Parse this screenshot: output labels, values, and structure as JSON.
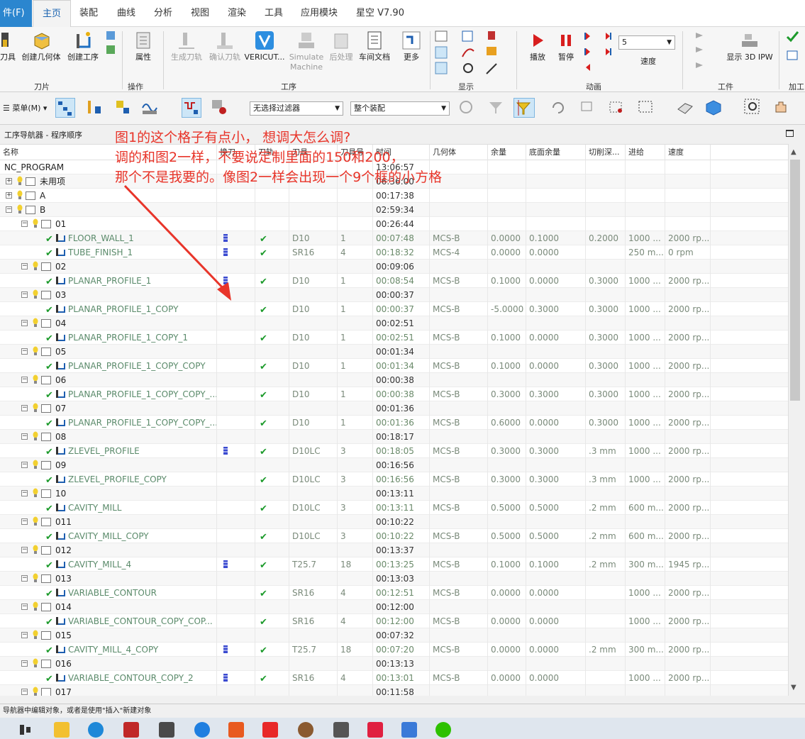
{
  "menu": {
    "file": "件(F)",
    "tabs": [
      "主页",
      "装配",
      "曲线",
      "分析",
      "视图",
      "渲染",
      "工具",
      "应用模块",
      "星空 V7.90"
    ]
  },
  "ribbon": {
    "buttons": {
      "tool": "刀具",
      "create_geometry": "创建几何体",
      "create_process": "创建工序",
      "attribute": "属性",
      "gen_toolpath": "生成刀轨",
      "verify_toolpath": "确认刀轨",
      "vericut": "VERICUT...",
      "simulate": "Simulate Machine",
      "post": "后处理",
      "shop_doc": "车间文档",
      "more": "更多",
      "play": "播放",
      "pause": "暂停",
      "speed": "速度",
      "speed_value": "5",
      "show_ipw": "显示 3D IPW"
    },
    "groups": {
      "cutter": "刀片",
      "operation": "操作",
      "process": "工序",
      "display": "显示",
      "animation": "动画",
      "workpiece": "工件",
      "machining": "加工"
    }
  },
  "toolbar": {
    "menu_label": "菜单(M)",
    "filter_select": "无选择过滤器",
    "assembly_select": "整个装配"
  },
  "navigator": {
    "title": "工序导航器 - 程序顺序",
    "columns": [
      "名称",
      "换刀",
      "刀轨",
      "刀具",
      "刀具号",
      "时间",
      "几何体",
      "余量",
      "底面余量",
      "切削深...",
      "进给",
      "速度"
    ],
    "rows": [
      {
        "name": "NC_PROGRAM",
        "time": "13:06:57"
      },
      {
        "name": "未用项",
        "time": "06:36:00"
      },
      {
        "name": "A",
        "time": "00:17:38"
      },
      {
        "name": "B",
        "time": "02:59:34"
      },
      {
        "name": "01",
        "time": "00:26:44"
      },
      {
        "name": "FLOOR_WALL_1",
        "tool": "D10",
        "toolno": "1",
        "time": "00:07:48",
        "geom": "MCS-B",
        "stock": "0.0000",
        "floor": "0.1000",
        "depth": "0.2000",
        "feed": "1000 ...",
        "speed": "2000 rp..."
      },
      {
        "name": "TUBE_FINISH_1",
        "tool": "SR16",
        "toolno": "4",
        "time": "00:18:32",
        "geom": "MCS-4",
        "stock": "0.0000",
        "floor": "0.0000",
        "depth": "",
        "feed": "250 m...",
        "speed": "0 rpm"
      },
      {
        "name": "02",
        "time": "00:09:06"
      },
      {
        "name": "PLANAR_PROFILE_1",
        "tool": "D10",
        "toolno": "1",
        "time": "00:08:54",
        "geom": "MCS-B",
        "stock": "0.1000",
        "floor": "0.0000",
        "depth": "0.3000",
        "feed": "1000 ...",
        "speed": "2000 rp..."
      },
      {
        "name": "03",
        "time": "00:00:37"
      },
      {
        "name": "PLANAR_PROFILE_1_COPY",
        "tool": "D10",
        "toolno": "1",
        "time": "00:00:37",
        "geom": "MCS-B",
        "stock": "-5.0000",
        "floor": "0.3000",
        "depth": "0.3000",
        "feed": "1000 ...",
        "speed": "2000 rp..."
      },
      {
        "name": "04",
        "time": "00:02:51"
      },
      {
        "name": "PLANAR_PROFILE_1_COPY_1",
        "tool": "D10",
        "toolno": "1",
        "time": "00:02:51",
        "geom": "MCS-B",
        "stock": "0.1000",
        "floor": "0.0000",
        "depth": "0.3000",
        "feed": "1000 ...",
        "speed": "2000 rp..."
      },
      {
        "name": "05",
        "time": "00:01:34"
      },
      {
        "name": "PLANAR_PROFILE_1_COPY_COPY",
        "tool": "D10",
        "toolno": "1",
        "time": "00:01:34",
        "geom": "MCS-B",
        "stock": "0.1000",
        "floor": "0.0000",
        "depth": "0.3000",
        "feed": "1000 ...",
        "speed": "2000 rp..."
      },
      {
        "name": "06",
        "time": "00:00:38"
      },
      {
        "name": "PLANAR_PROFILE_1_COPY_COPY_...",
        "tool": "D10",
        "toolno": "1",
        "time": "00:00:38",
        "geom": "MCS-B",
        "stock": "0.3000",
        "floor": "0.3000",
        "depth": "0.3000",
        "feed": "1000 ...",
        "speed": "2000 rp..."
      },
      {
        "name": "07",
        "time": "00:01:36"
      },
      {
        "name": "PLANAR_PROFILE_1_COPY_COPY_...",
        "tool": "D10",
        "toolno": "1",
        "time": "00:01:36",
        "geom": "MCS-B",
        "stock": "0.6000",
        "floor": "0.0000",
        "depth": "0.3000",
        "feed": "1000 ...",
        "speed": "2000 rp..."
      },
      {
        "name": "08",
        "time": "00:18:17"
      },
      {
        "name": "ZLEVEL_PROFILE",
        "tool": "D10LC",
        "toolno": "3",
        "time": "00:18:05",
        "geom": "MCS-B",
        "stock": "0.3000",
        "floor": "0.3000",
        "depth": ".3 mm",
        "feed": "1000 ...",
        "speed": "2000 rp..."
      },
      {
        "name": "09",
        "time": "00:16:56"
      },
      {
        "name": "ZLEVEL_PROFILE_COPY",
        "tool": "D10LC",
        "toolno": "3",
        "time": "00:16:56",
        "geom": "MCS-B",
        "stock": "0.3000",
        "floor": "0.3000",
        "depth": ".3 mm",
        "feed": "1000 ...",
        "speed": "2000 rp..."
      },
      {
        "name": "10",
        "time": "00:13:11"
      },
      {
        "name": "CAVITY_MILL",
        "tool": "D10LC",
        "toolno": "3",
        "time": "00:13:11",
        "geom": "MCS-B",
        "stock": "0.5000",
        "floor": "0.5000",
        "depth": ".2 mm",
        "feed": "600 m...",
        "speed": "2000 rp..."
      },
      {
        "name": "011",
        "time": "00:10:22"
      },
      {
        "name": "CAVITY_MILL_COPY",
        "tool": "D10LC",
        "toolno": "3",
        "time": "00:10:22",
        "geom": "MCS-B",
        "stock": "0.5000",
        "floor": "0.5000",
        "depth": ".2 mm",
        "feed": "600 m...",
        "speed": "2000 rp..."
      },
      {
        "name": "012",
        "time": "00:13:37"
      },
      {
        "name": "CAVITY_MILL_4",
        "tool": "T25.7",
        "toolno": "18",
        "time": "00:13:25",
        "geom": "MCS-B",
        "stock": "0.1000",
        "floor": "0.1000",
        "depth": ".2 mm",
        "feed": "300 m...",
        "speed": "1945 rp..."
      },
      {
        "name": "013",
        "time": "00:13:03"
      },
      {
        "name": "VARIABLE_CONTOUR",
        "tool": "SR16",
        "toolno": "4",
        "time": "00:12:51",
        "geom": "MCS-B",
        "stock": "0.0000",
        "floor": "0.0000",
        "depth": "",
        "feed": "1000 ...",
        "speed": "2000 rp..."
      },
      {
        "name": "014",
        "time": "00:12:00"
      },
      {
        "name": "VARIABLE_CONTOUR_COPY_COP...",
        "tool": "SR16",
        "toolno": "4",
        "time": "00:12:00",
        "geom": "MCS-B",
        "stock": "0.0000",
        "floor": "0.0000",
        "depth": "",
        "feed": "1000 ...",
        "speed": "2000 rp..."
      },
      {
        "name": "015",
        "time": "00:07:32"
      },
      {
        "name": "CAVITY_MILL_4_COPY",
        "tool": "T25.7",
        "toolno": "18",
        "time": "00:07:20",
        "geom": "MCS-B",
        "stock": "0.0000",
        "floor": "0.0000",
        "depth": ".2 mm",
        "feed": "300 m...",
        "speed": "2000 rp..."
      },
      {
        "name": "016",
        "time": "00:13:13"
      },
      {
        "name": "VARIABLE_CONTOUR_COPY_2",
        "tool": "SR16",
        "toolno": "4",
        "time": "00:13:01",
        "geom": "MCS-B",
        "stock": "0.0000",
        "floor": "0.0000",
        "depth": "",
        "feed": "1000 ...",
        "speed": "2000 rp..."
      },
      {
        "name": "017",
        "time": "00:11:58"
      }
    ]
  },
  "annotation": {
    "line1": "图1的这个格子有点小， 想调大怎么调?",
    "line2": "调的和图2一样，不要说定制里面的150和200，",
    "line3": "那个不是我要的。像图2一样会出现一个9个框的小方格",
    "color": "#e8352a"
  },
  "status": "导航器中编辑对象，或者是使用\"插入\"新建对象"
}
